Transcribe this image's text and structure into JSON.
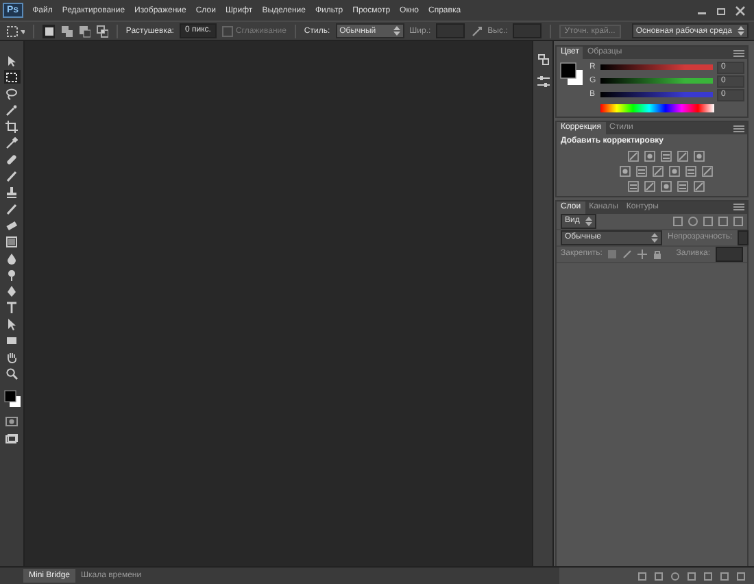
{
  "app_logo": "Ps",
  "menu": [
    "Файл",
    "Редактирование",
    "Изображение",
    "Слои",
    "Шрифт",
    "Выделение",
    "Фильтр",
    "Просмотр",
    "Окно",
    "Справка"
  ],
  "options_bar": {
    "feather_label": "Растушевка:",
    "feather_value": "0 пикс.",
    "antialias": {
      "label": "Сглаживание",
      "checked": false,
      "disabled": true
    },
    "style_label": "Стиль:",
    "style_value": "Обычный",
    "width_label": "Шир.:",
    "height_label": "Выс.:",
    "refine_button": {
      "label": "Уточн. край...",
      "disabled": true
    },
    "workspace": "Основная рабочая среда"
  },
  "tools": [
    {
      "kind": "move",
      "selected": false
    },
    {
      "kind": "marquee",
      "selected": true
    },
    {
      "kind": "lasso",
      "selected": false
    },
    {
      "kind": "wand",
      "selected": false
    },
    {
      "kind": "crop",
      "selected": false
    },
    {
      "kind": "eyedropper",
      "selected": false
    },
    {
      "kind": "bandage",
      "selected": false
    },
    {
      "kind": "brush",
      "selected": false
    },
    {
      "kind": "stamp",
      "selected": false
    },
    {
      "kind": "brush",
      "selected": false
    },
    {
      "kind": "eraser",
      "selected": false
    },
    {
      "kind": "gradient",
      "selected": false
    },
    {
      "kind": "drop",
      "selected": false
    },
    {
      "kind": "dodge",
      "selected": false
    },
    {
      "kind": "pen",
      "selected": false
    },
    {
      "kind": "type",
      "selected": false
    },
    {
      "kind": "arrow",
      "selected": false
    },
    {
      "kind": "rect",
      "selected": false
    },
    {
      "kind": "hand",
      "selected": false
    },
    {
      "kind": "zoom",
      "selected": false
    }
  ],
  "color_panel": {
    "tabs": [
      {
        "label": "Цвет",
        "selected": true
      },
      {
        "label": "Образцы",
        "selected": false
      }
    ],
    "channels": [
      {
        "name": "R",
        "value": "0",
        "color": "#d03a3a"
      },
      {
        "name": "G",
        "value": "0",
        "color": "#3ab43a"
      },
      {
        "name": "B",
        "value": "0",
        "color": "#3a3ad0"
      }
    ]
  },
  "adjustments_panel": {
    "tabs": [
      {
        "label": "Коррекция",
        "selected": true
      },
      {
        "label": "Стили",
        "selected": false
      }
    ],
    "heading": "Добавить корректировку"
  },
  "layers_panel": {
    "tabs": [
      {
        "label": "Слои",
        "selected": true
      },
      {
        "label": "Каналы",
        "selected": false
      },
      {
        "label": "Контуры",
        "selected": false
      }
    ],
    "filter_label": "Вид",
    "blend_mode": "Обычные",
    "opacity_label": "Непрозрачность:",
    "lock_label": "Закрепить:",
    "fill_label": "Заливка:"
  },
  "bottom_tabs": [
    {
      "label": "Mini Bridge",
      "selected": true
    },
    {
      "label": "Шкала времени",
      "selected": false
    }
  ]
}
